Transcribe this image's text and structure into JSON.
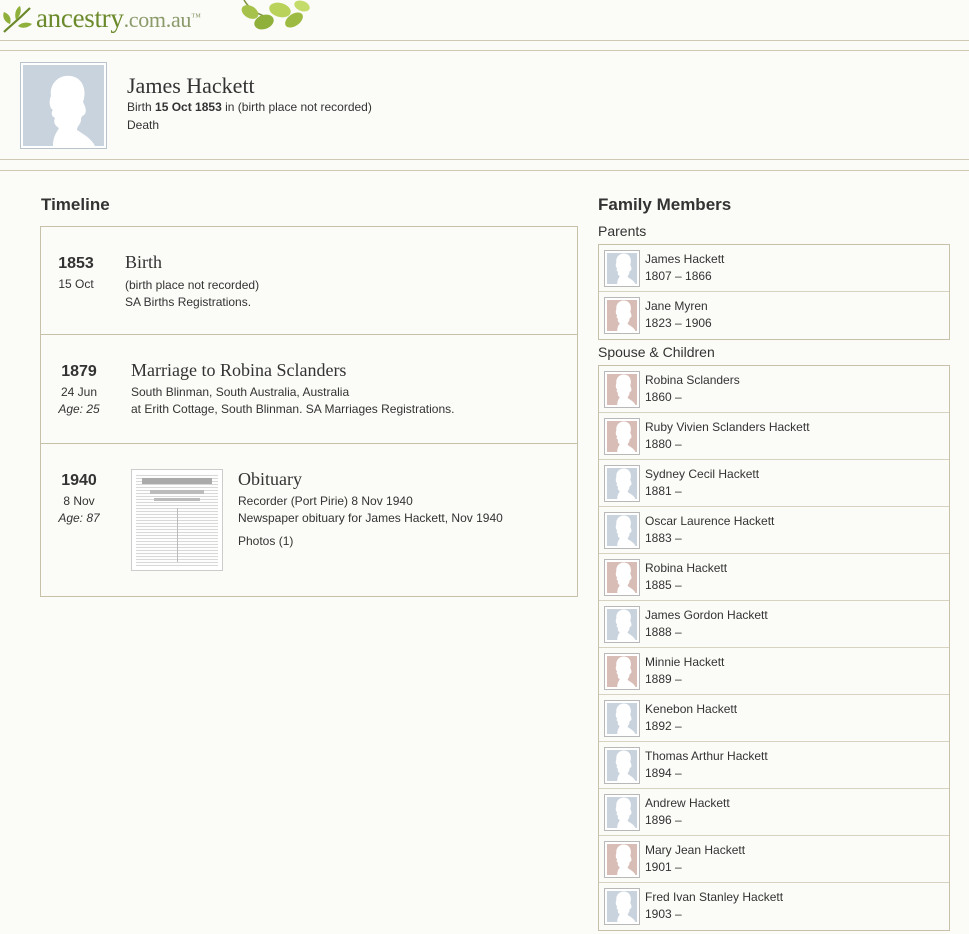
{
  "header": {
    "logo_main": "ancestry",
    "logo_domain": ".com.au",
    "logo_tm": "™"
  },
  "person": {
    "name": "James Hackett",
    "birth_label": "Birth",
    "birth_date": "15 Oct 1853",
    "birth_place_prefix": "in",
    "birth_place": "(birth place not recorded)",
    "death_label": "Death"
  },
  "timeline": {
    "title": "Timeline",
    "events": [
      {
        "year": "1853",
        "date": "15 Oct",
        "age": "",
        "title": "Birth",
        "line1": "(birth place not recorded)",
        "line2": "SA Births Registrations."
      },
      {
        "year": "1879",
        "date": "24 Jun",
        "age": "Age: 25",
        "title": "Marriage to Robina Sclanders",
        "line1": "South Blinman, South Australia, Australia",
        "line2": "at Erith Cottage, South Blinman. SA Marriages Registrations."
      },
      {
        "year": "1940",
        "date": "8 Nov",
        "age": "Age: 87",
        "title": "Obituary",
        "line1": "Recorder (Port Pirie) 8 Nov 1940",
        "line2": "Newspaper obituary for James Hackett, Nov 1940",
        "photos": "Photos (1)"
      }
    ]
  },
  "family": {
    "title": "Family Members",
    "parents_label": "Parents",
    "parents": [
      {
        "name": "James Hackett",
        "years": "1807 – 1866",
        "sex": "male"
      },
      {
        "name": "Jane Myren",
        "years": "1823 – 1906",
        "sex": "female"
      }
    ],
    "spouse_label": "Spouse & Children",
    "spouse_children": [
      {
        "name": "Robina Sclanders",
        "years": "1860 –",
        "sex": "female"
      },
      {
        "name": "Ruby Vivien Sclanders Hackett",
        "years": "1880 –",
        "sex": "female"
      },
      {
        "name": "Sydney Cecil Hackett",
        "years": "1881 –",
        "sex": "male"
      },
      {
        "name": "Oscar Laurence Hackett",
        "years": "1883 –",
        "sex": "male"
      },
      {
        "name": "Robina Hackett",
        "years": "1885 –",
        "sex": "female"
      },
      {
        "name": "James Gordon Hackett",
        "years": "1888 –",
        "sex": "male"
      },
      {
        "name": "Minnie Hackett",
        "years": "1889 –",
        "sex": "female"
      },
      {
        "name": "Kenebon Hackett",
        "years": "1892 –",
        "sex": "male"
      },
      {
        "name": "Thomas Arthur Hackett",
        "years": "1894 –",
        "sex": "male"
      },
      {
        "name": "Andrew Hackett",
        "years": "1896 –",
        "sex": "male"
      },
      {
        "name": "Mary Jean Hackett",
        "years": "1901 –",
        "sex": "female"
      },
      {
        "name": "Fred Ivan Stanley Hackett",
        "years": "1903 –",
        "sex": "male"
      }
    ]
  },
  "colors": {
    "brand_green": "#6b8a2b",
    "male_avatar": "#c9d3dd",
    "female_avatar": "#d8bcb6",
    "border": "#c7c1a9"
  }
}
